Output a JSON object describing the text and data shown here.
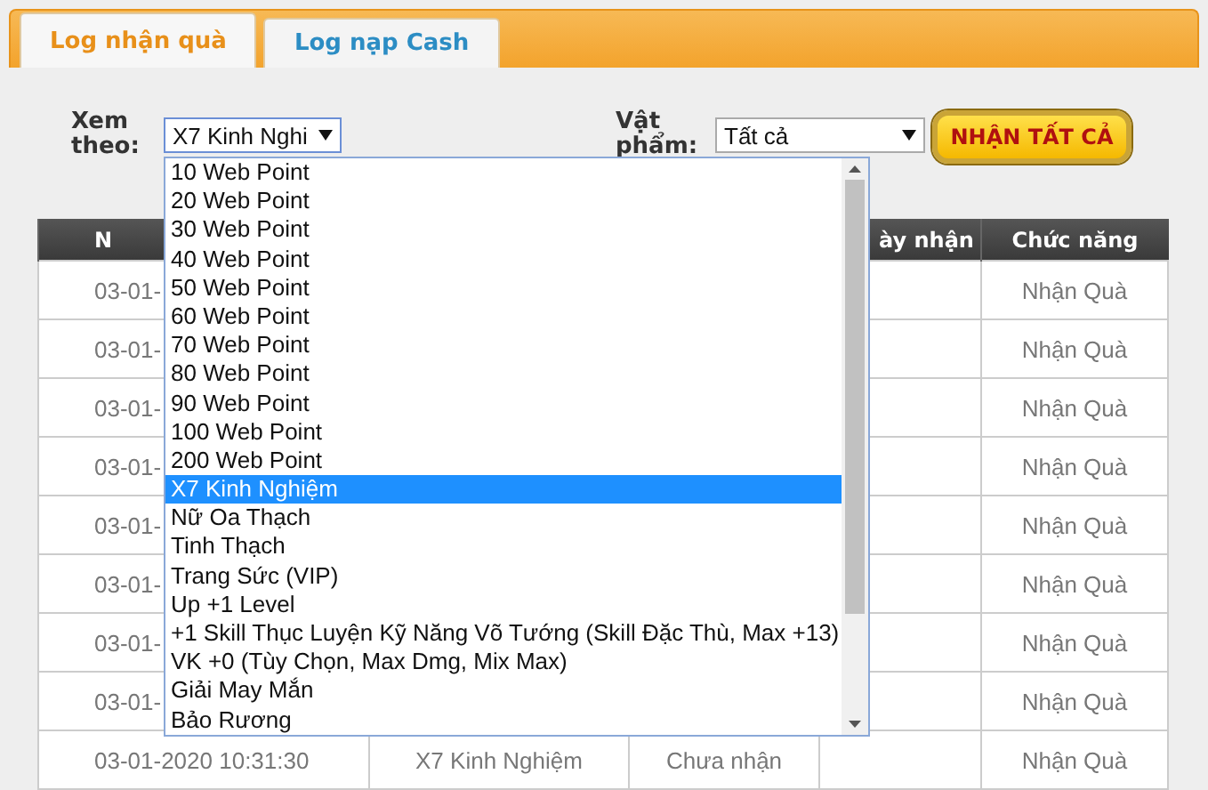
{
  "tabs": [
    {
      "label": "Log nhận quà",
      "selected": true
    },
    {
      "label": "Log nạp Cash",
      "selected": false
    }
  ],
  "filters": {
    "view_by": {
      "label": "Xem theo:",
      "value": "X7 Kinh Nghi"
    },
    "item": {
      "label": "Vật phẩm:",
      "value": "Tất cả"
    },
    "claim_all_button": "NHẬN TẤT CẢ"
  },
  "dropdown": {
    "options": [
      {
        "label": "10 Web Point",
        "selected": false
      },
      {
        "label": "20 Web Point",
        "selected": false
      },
      {
        "label": "30 Web Point",
        "selected": false
      },
      {
        "label": "40 Web Point",
        "selected": false
      },
      {
        "label": "50 Web Point",
        "selected": false
      },
      {
        "label": "60 Web Point",
        "selected": false
      },
      {
        "label": "70 Web Point",
        "selected": false
      },
      {
        "label": "80 Web Point",
        "selected": false
      },
      {
        "label": "90 Web Point",
        "selected": false
      },
      {
        "label": "100 Web Point",
        "selected": false
      },
      {
        "label": "200 Web Point",
        "selected": false
      },
      {
        "label": "X7 Kinh Nghiệm",
        "selected": true
      },
      {
        "label": "Nữ Oa Thạch",
        "selected": false
      },
      {
        "label": "Tinh Thạch",
        "selected": false
      },
      {
        "label": "Trang Sức (VIP)",
        "selected": false
      },
      {
        "label": "Up +1 Level",
        "selected": false
      },
      {
        "label": "+1 Skill Thục Luyện Kỹ Năng Võ Tướng (Skill Đặc Thù, Max +13)",
        "selected": false
      },
      {
        "label": "VK +0 (Tùy Chọn, Max Dmg, Mix Max)",
        "selected": false
      },
      {
        "label": "Giải May Mắn",
        "selected": false
      },
      {
        "label": "Bảo Rương",
        "selected": false
      }
    ]
  },
  "table": {
    "columns": {
      "column_1": "N",
      "column_4": "ày nhận",
      "column_5": "Chức năng"
    },
    "rows": [
      {
        "column_1": "03-01-",
        "column_5": "Nhận Quà"
      },
      {
        "column_1": "03-01-",
        "column_5": "Nhận Quà"
      },
      {
        "column_1": "03-01-",
        "column_5": "Nhận Quà"
      },
      {
        "column_1": "03-01-",
        "column_5": "Nhận Quà"
      },
      {
        "column_1": "03-01-",
        "column_5": "Nhận Quà"
      },
      {
        "column_1": "03-01-",
        "column_5": "Nhận Quà"
      },
      {
        "column_1": "03-01-",
        "column_5": "Nhận Quà"
      },
      {
        "column_1": "03-01-",
        "column_5": "Nhận Quà"
      },
      {
        "column_1": "03-01-2020 10:31:30",
        "column_2": "X7 Kinh Nghiệm",
        "column_3": "Chưa nhận",
        "column_5": "Nhận Quà"
      }
    ]
  }
}
